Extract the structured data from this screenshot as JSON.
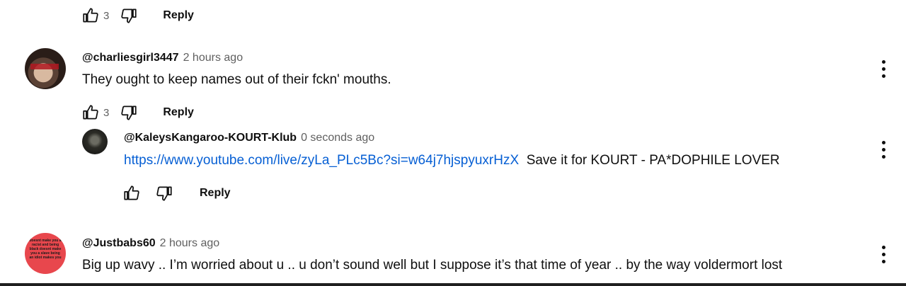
{
  "top_actions": {
    "like_count": "3",
    "reply_label": "Reply"
  },
  "comment1": {
    "handle": "@charliesgirl3447",
    "time": "2 hours ago",
    "text": "They ought to keep names out of their fckn' mouths.",
    "like_count": "3",
    "reply_label": "Reply"
  },
  "reply1": {
    "handle": "@KaleysKangaroo-KOURT-Klub",
    "time": "0 seconds ago",
    "link": "https://www.youtube.com/live/zyLa_PLc5Bc?si=w64j7hjspyuxrHzX",
    "text": "Save it for KOURT - PA*DOPHILE LOVER",
    "reply_label": "Reply"
  },
  "comment2": {
    "handle": "@Justbabs60",
    "time": "2 hours ago",
    "text": "Big up wavy .. I’m worried about u .. u don’t sound well but I suppose it’s that time of year .. by the way voldermort lost",
    "avatar_text": "doesnt make you a racist and being black doesnt make you a slave being an idiot makes you"
  },
  "icons": [
    "thumb-up-icon",
    "thumb-down-icon",
    "more-vert-icon"
  ],
  "colors": {
    "link": "#065fd4",
    "secondary_text": "#606060",
    "avatar_red": "#e8474d"
  }
}
